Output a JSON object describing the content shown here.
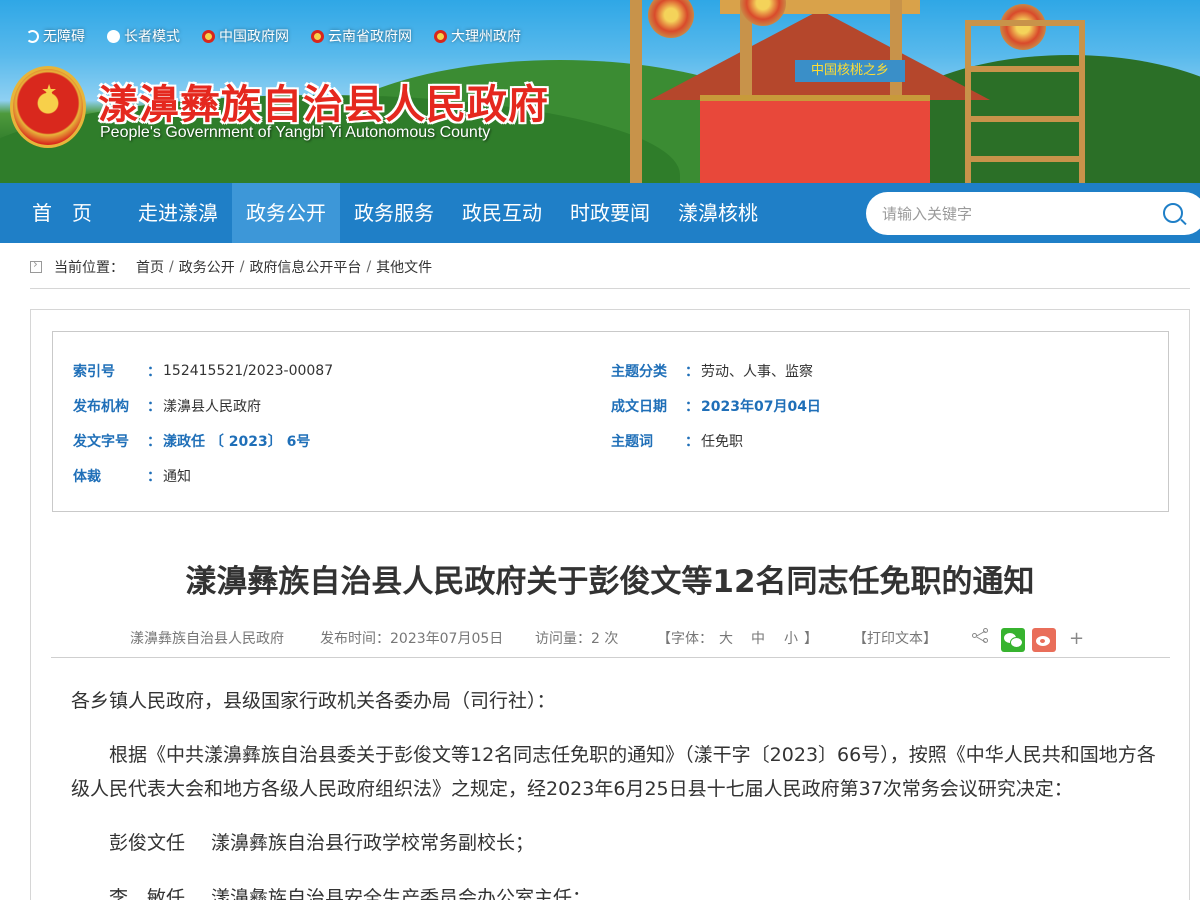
{
  "top_links": [
    {
      "label": "无障碍",
      "icon": "moon-icon"
    },
    {
      "label": "长者模式",
      "icon": "person-icon"
    },
    {
      "label": "中国政府网",
      "icon": "national-emblem-icon"
    },
    {
      "label": "云南省政府网",
      "icon": "national-emblem-icon"
    },
    {
      "label": "大理州政府",
      "icon": "national-emblem-icon"
    }
  ],
  "site": {
    "title": "漾濞彝族自治县人民政府",
    "subtitle": "People's Government of Yangbi Yi Autonomous County",
    "banner_sign": "中国核桃之乡"
  },
  "nav": {
    "items": [
      {
        "label": "首页",
        "active": false
      },
      {
        "label": "走进漾濞",
        "active": false
      },
      {
        "label": "政务公开",
        "active": true
      },
      {
        "label": "政务服务",
        "active": false
      },
      {
        "label": "政民互动",
        "active": false
      },
      {
        "label": "时政要闻",
        "active": false
      },
      {
        "label": "漾濞核桃",
        "active": false
      }
    ],
    "search_placeholder": "请输入关键字"
  },
  "breadcrumb": {
    "label": "当前位置：",
    "items": [
      "首页",
      "政务公开",
      "政府信息公开平台",
      "其他文件"
    ],
    "separator": "/"
  },
  "meta": {
    "index_no": {
      "key": "索引号",
      "value": "152415521/2023-00087"
    },
    "publisher": {
      "key": "发布机构",
      "value": "漾濞县人民政府"
    },
    "doc_no": {
      "key": "发文字号",
      "value": "漾政任 〔 2023〕 6号"
    },
    "genre": {
      "key": "体裁",
      "value": "通知"
    },
    "topic": {
      "key": "主题分类",
      "value": "劳动、人事、监察"
    },
    "date": {
      "key": "成文日期",
      "value": "2023年07月04日"
    },
    "keyword": {
      "key": "主题词",
      "value": "任免职"
    },
    "colon": "："
  },
  "article": {
    "title": "漾濞彝族自治县人民政府关于彭俊文等12名同志任免职的通知",
    "source": "漾濞彝族自治县人民政府",
    "publish_time": "发布时间：2023年07月05日",
    "visits": "访问量：2 次",
    "font_label": "【字体：",
    "font_large": "大",
    "font_medium": "中",
    "font_small": "小",
    "font_close": "】",
    "print": "【打印文本】",
    "plus": "+",
    "greeting": "各乡镇人民政府，县级国家行政机关各委办局（司行社）：",
    "paragraph": "根据《中共漾濞彝族自治县委关于彭俊文等12名同志任免职的通知》（漾干字〔2023〕66号），按照《中华人民共和国地方各级人民代表大会和地方各级人民政府组织法》之规定，经2023年6月25日县十七届人民政府第37次常务会议研究决定：",
    "appointments": [
      {
        "name": "彭俊文任",
        "position": "漾濞彝族自治县行政学校常务副校长；"
      },
      {
        "name": "李　敏任",
        "position": "漾濞彝族自治县安全生产委员会办公室主任；"
      }
    ]
  }
}
